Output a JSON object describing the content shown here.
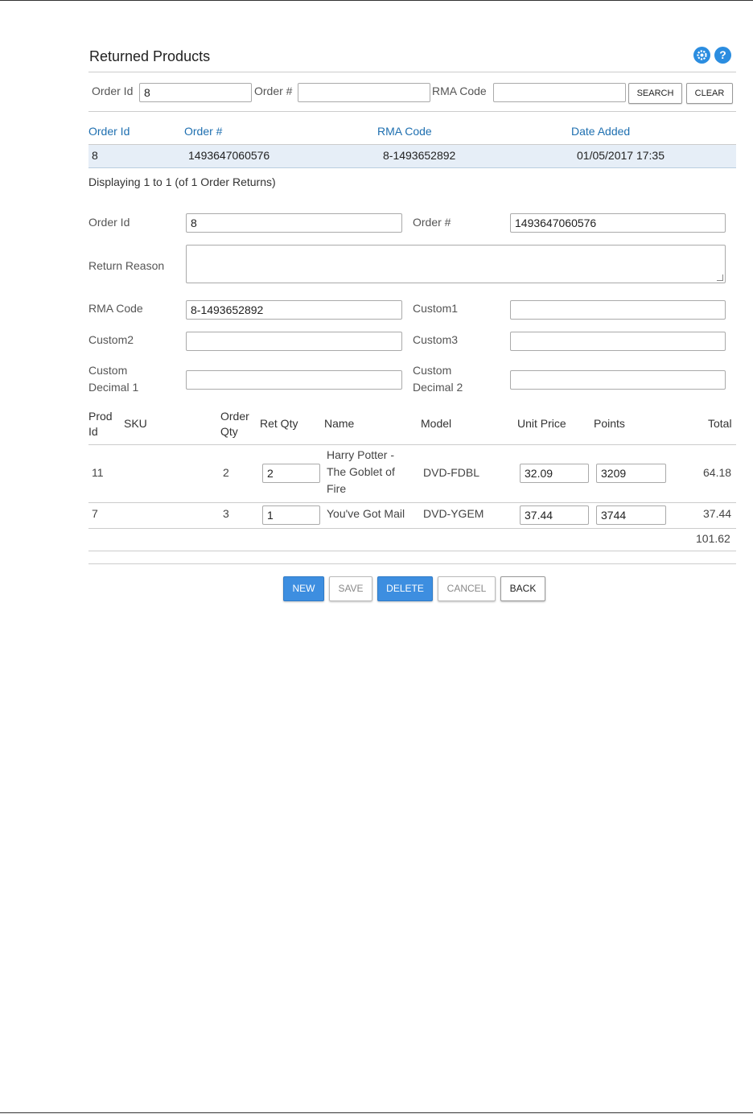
{
  "header": {
    "title": "Returned Products",
    "gear_icon": "gear-icon",
    "help_icon": "help-icon",
    "accent_color": "#2b8de0"
  },
  "search": {
    "order_id_label": "Order Id",
    "order_id_value": "8",
    "order_num_label": "Order #",
    "order_num_value": "",
    "rma_label": "RMA Code",
    "rma_value": "",
    "search_button": "SEARCH",
    "clear_button": "CLEAR"
  },
  "list": {
    "columns": [
      "Order Id",
      "Order #",
      "RMA Code",
      "Date Added"
    ],
    "rows": [
      {
        "order_id": "8",
        "order_num": "1493647060576",
        "rma_code": "8-1493652892",
        "date_added": "01/05/2017 17:35"
      }
    ],
    "display_text": "Displaying 1 to 1 (of 1 Order Returns)"
  },
  "detail": {
    "order_id_label": "Order Id",
    "order_id_value": "8",
    "order_num_label": "Order #",
    "order_num_value": "1493647060576",
    "return_reason_label": "Return Reason",
    "return_reason_value": "",
    "rma_label": "RMA Code",
    "rma_value": "8-1493652892",
    "custom1_label": "Custom1",
    "custom1_value": "",
    "custom2_label": "Custom2",
    "custom2_value": "",
    "custom3_label": "Custom3",
    "custom3_value": "",
    "custom_decimal1_label_line1": "Custom",
    "custom_decimal1_label_line2": "Decimal 1",
    "custom_decimal1_value": "",
    "custom_decimal2_label_line1": "Custom",
    "custom_decimal2_label_line2": "Decimal 2",
    "custom_decimal2_value": ""
  },
  "products": {
    "headers": {
      "prod_id_line1": "Prod",
      "prod_id_line2": "Id",
      "sku": "SKU",
      "order_qty_line1": "Order",
      "order_qty_line2": "Qty",
      "ret_qty": "Ret Qty",
      "name": "Name",
      "model": "Model",
      "unit_price": "Unit Price",
      "points": "Points",
      "total": "Total"
    },
    "rows": [
      {
        "prod_id": "11",
        "sku": "",
        "order_qty": "2",
        "ret_qty": "2",
        "name_line1": "Harry Potter -",
        "name_line2": "The Goblet of",
        "name_line3": "Fire",
        "model": "DVD-FDBL",
        "unit_price": "32.09",
        "points": "3209",
        "total": "64.18"
      },
      {
        "prod_id": "7",
        "sku": "",
        "order_qty": "3",
        "ret_qty": "1",
        "name_line1": "You've Got Mail",
        "model": "DVD-YGEM",
        "unit_price": "37.44",
        "points": "3744",
        "total": "37.44"
      }
    ],
    "grand_total": "101.62"
  },
  "actions": {
    "new": "NEW",
    "save": "SAVE",
    "delete": "DELETE",
    "cancel": "CANCEL",
    "back": "BACK"
  }
}
